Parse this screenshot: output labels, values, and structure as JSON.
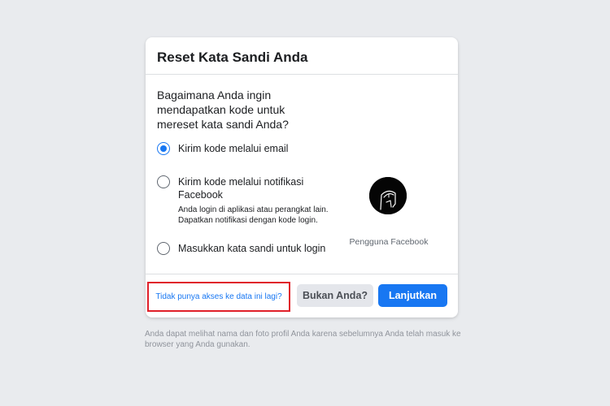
{
  "card": {
    "title": "Reset Kata Sandi Anda",
    "question": "Bagaimana Anda ingin mendapatkan kode untuk mereset kata sandi Anda?",
    "options": [
      {
        "label": "Kirim kode melalui email",
        "description": "",
        "checked": true
      },
      {
        "label": "Kirim kode melalui notifikasi Facebook",
        "description": "Anda login di aplikasi atau perangkat lain. Dapatkan notifikasi dengan kode login.",
        "checked": false
      },
      {
        "label": "Masukkan kata sandi untuk login",
        "description": "",
        "checked": false
      }
    ],
    "profile": {
      "name": "Pengguna Facebook",
      "avatar_icon": "default-avatar-icon"
    }
  },
  "footer": {
    "no_access_link": "Tidak punya akses ke data ini lagi?",
    "not_you_button": "Bukan Anda?",
    "continue_button": "Lanjutkan"
  },
  "note": "Anda dapat melihat nama dan foto profil Anda karena sebelumnya Anda telah masuk ke browser yang Anda gunakan.",
  "colors": {
    "background": "#e9ebee",
    "primary": "#1877f2",
    "highlight_border": "#e0202a"
  }
}
